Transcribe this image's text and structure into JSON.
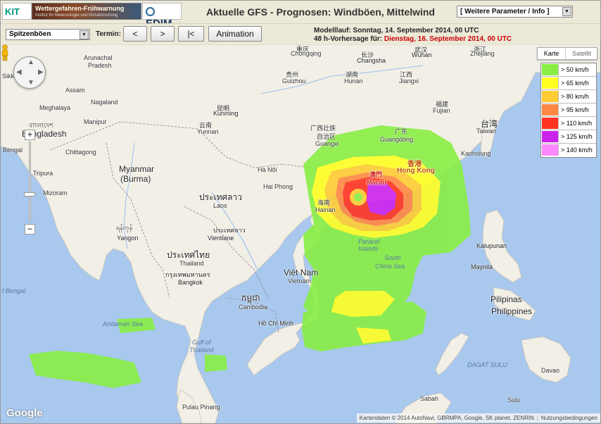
{
  "header": {
    "logo_kit": "KIT",
    "logo_wfw_title": "Wettergefahren-Frühwarnung",
    "logo_wfw_sub": "Institut für Meteorologie und Klimaforschung",
    "logo_cedim": "EDIM",
    "title": "Aktuelle GFS - Prognosen: Windböen, Mittelwind",
    "param_select": "[ Weitere Parameter / Info ]"
  },
  "controls": {
    "variable_select": "Spitzenböen",
    "termin_label": "Termin:",
    "prev_label": "<",
    "next_label": ">",
    "first_label": "|<",
    "animation_label": "Animation",
    "modelrun_label": "Modelllauf: Sonntag, 14. September 2014, 00 UTC",
    "forecast_label": "48 h-Vorhersage für:",
    "forecast_value": "Dienstag, 16. September 2014, 00 UTC"
  },
  "maptype": {
    "map": "Karte",
    "satellite": "Satellit"
  },
  "legend": [
    {
      "label": "> 50 km/h",
      "color": "#88ee44"
    },
    {
      "label": "> 65 km/h",
      "color": "#ffff22"
    },
    {
      "label": "> 80 km/h",
      "color": "#ffcc33"
    },
    {
      "label": "> 95 km/h",
      "color": "#ff8844"
    },
    {
      "label": "> 110 km/h",
      "color": "#ff3322"
    },
    {
      "label": "> 125 km/h",
      "color": "#cc22ee"
    },
    {
      "label": "> 140 km/h",
      "color": "#ff88ff"
    }
  ],
  "map_labels": {
    "myanmar": "Myanmar",
    "burma": "(Burma)",
    "laos_th": "ประเทศลาว",
    "laos": "Laos",
    "thailand_th": "ประเทศไทย",
    "thailand": "Thailand",
    "vietnam": "Việt Nam",
    "vietnam_sub": "Vietnam",
    "cambodia_km": "កម្ពុជា",
    "cambodia": "Cambodia",
    "pilipinas": "Pilipinas",
    "philippines": "Philippines",
    "bangladesh": "Bangladesh",
    "bangladesh_bn": "বাংলাদেশ",
    "assam": "Assam",
    "meghalaya": "Meghalaya",
    "nagaland": "Nagaland",
    "manipur": "Manipur",
    "tripura": "Tripura",
    "mizoram": "Mizoram",
    "chittagong": "Chittagong",
    "bengal": "Bengal",
    "sikkim": "Sikki",
    "arunachal": "Arunachal",
    "pradesh": "Pradesh",
    "yunnan_cn": "云南",
    "yunnan": "Yunnan",
    "guizhou_cn": "贵州",
    "guizhou": "Guizhou",
    "hunan_cn": "湖南",
    "hunan": "Hunan",
    "jiangxi_cn": "江西",
    "jiangxi": "Jiangxi",
    "fujian_cn": "福建",
    "fujian": "Fujian",
    "zhejiang_cn": "浙江",
    "zhejiang": "Zhejiang",
    "chongqing_cn": "重庆",
    "chongqing": "Chongqing",
    "wuhan_cn": "武汉",
    "wuhan": "Wuhan",
    "changsha_cn": "长沙",
    "changsha": "Changsha",
    "guangxi_cn": "广西壮族",
    "guangxi_cn2": "自治区",
    "guangxi": "Guangxi",
    "guangdong_cn": "广东",
    "guangdong": "Guangdong",
    "kunming_cn": "昆明",
    "kunming": "Kunming",
    "taiwan_cn": "台湾",
    "taiwan": "Taiwan",
    "kaohsiung": "Kaohsiung",
    "hongkong_cn": "香港",
    "hongkong": "Hong Kong",
    "macau_cn": "澳門",
    "macau": "Macau",
    "hanoi": "Hà Nội",
    "haiphong": "Hai Phong",
    "hainan_cn": "海南",
    "hainan": "Hainan",
    "vientiane": "Vientiane",
    "yangon_my": "ရန်ကုန်",
    "yangon": "Yangon",
    "bangkok_th": "กรุงเทพมหานคร",
    "bangkok": "Bangkok",
    "hcm": "Hồ Chí Minh",
    "manila": "Maynila",
    "manila_en": "Manila",
    "kalupunan": "Kalupunan",
    "davao": "Davao",
    "pulau_pinang": "Pulau Pinang",
    "sabah": "Sabah",
    "sulu": "Sulu",
    "south_china_sea": "South",
    "south_china_sea2": "China Sea",
    "andaman": "Andaman Sea",
    "gulf": "Gulf of",
    "gulf2": "Thailand",
    "bay_bengal": "f Bengal",
    "paracel": "Paracel",
    "paracel2": "Islands",
    "dagat": "DAGAT SULU",
    "zhejiang_abbr": "Zhe"
  },
  "attribution": {
    "text": "Kartendaten © 2014 AutoNavi, GBRMPA, Google, SK planet, ZENRIN",
    "terms": "Nutzungsbedingungen",
    "google": "Google"
  },
  "map_controls": {
    "zoom_in": "+",
    "zoom_out": "−"
  }
}
